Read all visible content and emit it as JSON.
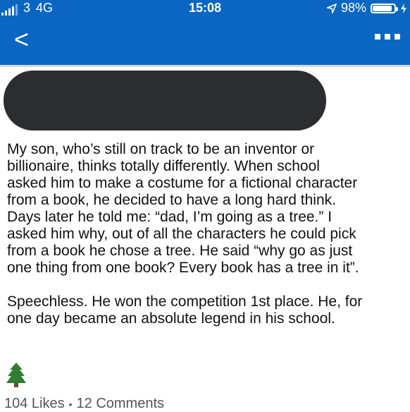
{
  "status_bar": {
    "carrier": "3",
    "network": "4G",
    "time": "15:08",
    "battery_percent": "98%",
    "battery_level": 0.98,
    "location_icon": "location-arrow-icon",
    "charging_icon": "charging-bolt-icon"
  },
  "nav": {
    "back_glyph": "<",
    "more_icon": "more-dots-icon"
  },
  "colors": {
    "header": "#0a66c2",
    "redaction": "#2b2d30"
  },
  "post": {
    "paragraph1": "My son, who’s still on track to be an inventor or\nbillionaire, thinks totally differently. When school\nasked him to make a costume for a fictional character\nfrom a book, he decided to have a long hard think.\nDays later he told me: “dad, I’m going as a tree.” I\nasked him why, out of all the characters he could pick\nfrom a book he chose a tree. He said “why go as just\none thing from one book? Every book has a tree in it”.",
    "paragraph2": "Speechless. He won the competition 1st place. He, for\none day became an absolute legend in his school.",
    "emoji_icon": "evergreen-tree-icon"
  },
  "engagement": {
    "likes": "104 Likes",
    "separator": "•",
    "comments": "12 Comments"
  }
}
